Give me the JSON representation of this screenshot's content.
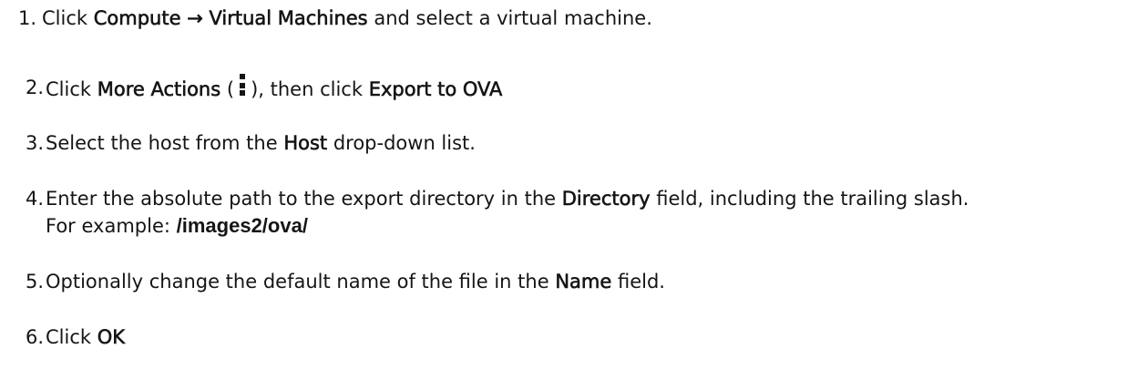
{
  "steps": [
    {
      "number": "1.",
      "text_1": "Click",
      "gui_1": "Compute",
      "arrow": "→",
      "gui_2": "Virtual Machines",
      "text_2": "and select a virtual machine."
    },
    {
      "number": "2.",
      "text_1": "Click",
      "gui_1": "More Actions",
      "open_paren": "(",
      "icon": "more-actions-kebab-icon",
      "close_paren": "), then click",
      "gui_2": "Export to OVA"
    },
    {
      "number": "3.",
      "text_1": "Select the host from the",
      "gui_1": "Host",
      "text_2": "drop-down list."
    },
    {
      "number": "4.",
      "text_1": "Enter the absolute path to the export directory in the",
      "gui_1": "Directory",
      "text_2": "field, including the trailing slash.",
      "example_label": "For example:",
      "example_code": "/images2/ova/"
    },
    {
      "number": "5.",
      "text_1": "Optionally change the default name of the file in the",
      "gui_1": "Name",
      "text_2": "field."
    },
    {
      "number": "6.",
      "text_1": "Click",
      "gui_1": "OK"
    }
  ]
}
